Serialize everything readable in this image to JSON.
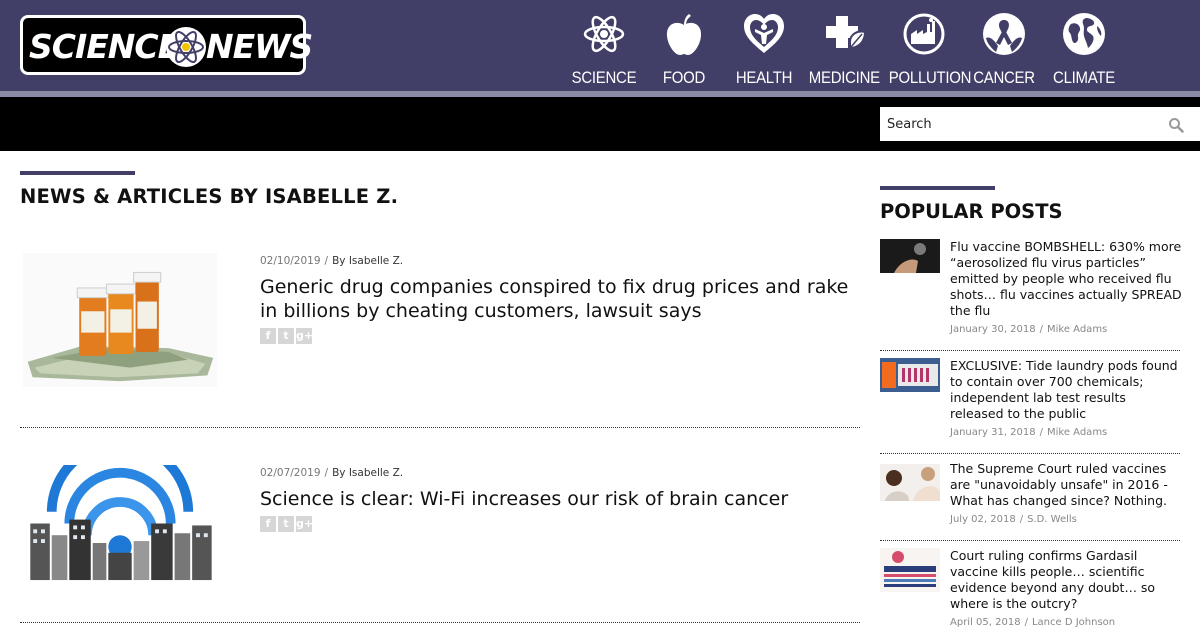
{
  "site": {
    "logo_left": "SCIENCE",
    "logo_right": "NEWS"
  },
  "nav": [
    {
      "label": "SCIENCE",
      "icon": "atom-icon"
    },
    {
      "label": "FOOD",
      "icon": "apple-icon"
    },
    {
      "label": "HEALTH",
      "icon": "heart-icon"
    },
    {
      "label": "MEDICINE",
      "icon": "medical-cross-icon"
    },
    {
      "label": "POLLUTION",
      "icon": "factory-icon"
    },
    {
      "label": "CANCER",
      "icon": "cancer-ribbon-icon"
    },
    {
      "label": "CLIMATE",
      "icon": "globe-icon"
    }
  ],
  "search": {
    "placeholder": "Search"
  },
  "main": {
    "title": "NEWS & ARTICLES BY ISABELLE Z.",
    "articles": [
      {
        "date": "02/10/2019",
        "author": "By Isabelle Z.",
        "title": "Generic drug companies conspired to fix drug prices and rake in billions by cheating customers, lawsuit says",
        "image": "pill-bottles-and-money"
      },
      {
        "date": "02/07/2019",
        "author": "By Isabelle Z.",
        "title": "Science is clear: Wi-Fi increases our risk of brain cancer",
        "image": "wifi-city-skyline"
      }
    ]
  },
  "sidebar": {
    "title": "POPULAR POSTS",
    "posts": [
      {
        "title": "Flu vaccine BOMBSHELL: 630% more “aerosolized flu virus particles” emitted by people who received flu shots… flu vaccines actually SPREAD the flu",
        "date": "January 30, 2018",
        "author": "Mike Adams"
      },
      {
        "title": "EXCLUSIVE: Tide laundry pods found to contain over 700 chemicals; independent lab test results released to the public",
        "date": "January 31, 2018",
        "author": "Mike Adams"
      },
      {
        "title": "The Supreme Court ruled vaccines are \"unavoidably unsafe\" in 2016 - What has changed since? Nothing.",
        "date": "July 02, 2018",
        "author": "S.D. Wells"
      },
      {
        "title": "Court ruling confirms Gardasil vaccine kills people… scientific evidence beyond any doubt… so where is the outcry?",
        "date": "April 05, 2018",
        "author": "Lance D Johnson"
      }
    ]
  },
  "colors": {
    "header": "#413f67",
    "strip": "#8b8aa6",
    "bar": "#000000"
  }
}
